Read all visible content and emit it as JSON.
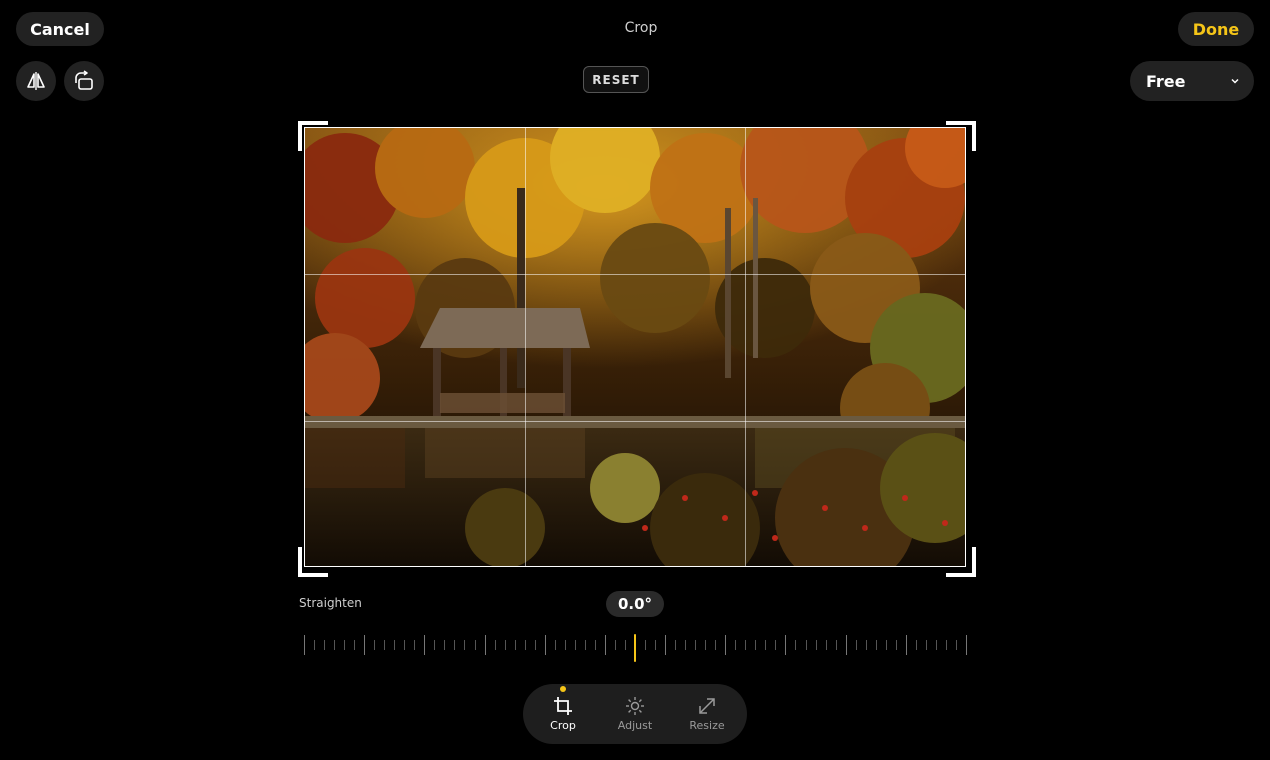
{
  "header": {
    "cancel_label": "Cancel",
    "title": "Crop",
    "done_label": "Done",
    "reset_label": "RESET",
    "aspect_label": "Free"
  },
  "straighten": {
    "label": "Straighten",
    "angle": "0.0°"
  },
  "toolbar": {
    "items": [
      {
        "label": "Crop",
        "icon": "crop-icon",
        "active": true
      },
      {
        "label": "Adjust",
        "icon": "brightness-icon",
        "active": false
      },
      {
        "label": "Resize",
        "icon": "resize-icon",
        "active": false
      }
    ]
  },
  "colors": {
    "accent": "#f5c518",
    "background": "#000000",
    "button_bg": "#222222"
  },
  "icons": [
    "flip-horizontal-icon",
    "rotate-icon",
    "chevron-down-icon"
  ]
}
